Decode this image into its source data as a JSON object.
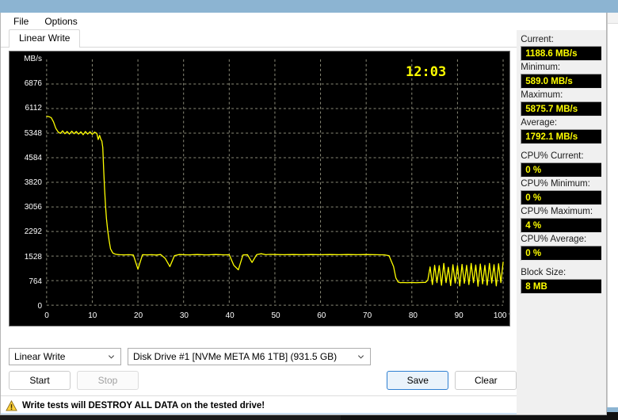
{
  "window": {
    "menu": [
      {
        "label": "File"
      },
      {
        "label": "Options"
      }
    ],
    "tabs": [
      {
        "label": "Linear Write",
        "active": true
      }
    ]
  },
  "chart": {
    "timer": "12:03",
    "y_axis_title": "MB/s",
    "x_axis_unit": "%",
    "y_ticks": [
      "6876",
      "6112",
      "5348",
      "4584",
      "3820",
      "3056",
      "2292",
      "1528",
      "764",
      "0"
    ],
    "x_ticks": [
      "0",
      "10",
      "20",
      "30",
      "40",
      "50",
      "60",
      "70",
      "80",
      "90",
      "100 %"
    ],
    "line_color": "#ffff00",
    "grid_color": "#8a8a78",
    "background_color": "#000000"
  },
  "chart_data": {
    "type": "line",
    "title": "Linear Write",
    "xlabel": "%",
    "ylabel": "MB/s",
    "xlim": [
      0,
      100
    ],
    "ylim": [
      0,
      7640
    ],
    "grid": true,
    "legend": null,
    "series": [
      {
        "name": "Linear Write",
        "color": "#ffff00",
        "x": [
          0,
          0.5,
          1,
          1.5,
          2,
          2.5,
          3,
          3.5,
          4,
          4.5,
          5,
          5.5,
          6,
          6.5,
          7,
          7.5,
          8,
          8.5,
          9,
          9.5,
          10,
          10.5,
          11,
          11.3,
          11.6,
          11.9,
          12.1,
          12.3,
          12.5,
          12.7,
          12.9,
          13.1,
          13.4,
          13.7,
          14,
          14.5,
          15,
          15.5,
          16,
          17,
          18,
          19,
          20,
          21,
          22,
          23,
          24,
          25,
          26,
          27,
          28,
          29,
          30,
          31,
          32,
          33,
          34,
          35,
          36,
          37,
          38,
          39,
          40,
          41,
          42,
          43,
          44,
          45,
          46,
          47,
          48,
          49,
          50,
          52,
          54,
          56,
          58,
          60,
          62,
          64,
          66,
          68,
          70,
          72,
          74,
          75,
          76,
          76.5,
          77,
          77.5,
          78,
          79,
          80,
          81,
          82,
          83,
          83.5,
          84,
          84.5,
          85,
          85.5,
          86,
          86.5,
          87,
          87.5,
          88,
          88.5,
          89,
          89.5,
          90,
          90.5,
          91,
          91.5,
          92,
          92.5,
          93,
          93.5,
          94,
          94.5,
          95,
          95.5,
          96,
          96.5,
          97,
          97.5,
          98,
          98.5,
          99,
          99.5,
          100
        ],
        "y": [
          5875,
          5860,
          5830,
          5700,
          5500,
          5390,
          5340,
          5420,
          5330,
          5400,
          5320,
          5410,
          5330,
          5400,
          5320,
          5390,
          5300,
          5400,
          5320,
          5390,
          5310,
          5380,
          5340,
          5150,
          5280,
          5150,
          5100,
          4900,
          4200,
          3600,
          3100,
          2700,
          2300,
          2000,
          1750,
          1620,
          1590,
          1575,
          1570,
          1565,
          1570,
          1560,
          1120,
          1570,
          1565,
          1570,
          1560,
          1575,
          1450,
          1200,
          1540,
          1575,
          1570,
          1565,
          1570,
          1575,
          1570,
          1565,
          1570,
          1575,
          1570,
          1565,
          1570,
          1240,
          1100,
          1560,
          1570,
          1330,
          1570,
          1600,
          1570,
          1580,
          1575,
          1570,
          1575,
          1570,
          1575,
          1570,
          1575,
          1570,
          1575,
          1570,
          1575,
          1570,
          1565,
          1540,
          1200,
          850,
          720,
          700,
          705,
          700,
          705,
          700,
          705,
          710,
          780,
          1190,
          640,
          1240,
          700,
          1230,
          620,
          1300,
          700,
          1180,
          610,
          1260,
          690,
          1230,
          600,
          1270,
          680,
          1240,
          640,
          1300,
          700,
          1250,
          590,
          1280,
          660,
          1240,
          620,
          1300,
          690,
          1260,
          600,
          1290,
          700,
          1340
        ]
      }
    ]
  },
  "controls": {
    "test_select": {
      "value": "Linear Write"
    },
    "drive_select": {
      "value": "Disk Drive #1  [NVMe   META M6 1TB]  (931.5 GB)"
    },
    "start_button": "Start",
    "stop_button": "Stop",
    "save_button": "Save",
    "clear_button": "Clear"
  },
  "warning": {
    "text": "Write tests will DESTROY ALL DATA on the tested drive!",
    "icon": "warning-triangle-icon"
  },
  "stats": [
    {
      "key": "current",
      "label": "Current:",
      "value": "1188.6 MB/s",
      "gap": false
    },
    {
      "key": "minimum",
      "label": "Minimum:",
      "value": "589.0 MB/s",
      "gap": false
    },
    {
      "key": "maximum",
      "label": "Maximum:",
      "value": "5875.7 MB/s",
      "gap": false
    },
    {
      "key": "average",
      "label": "Average:",
      "value": "1792.1 MB/s",
      "gap": false
    },
    {
      "key": "cpu_current",
      "label": "CPU% Current:",
      "value": "0 %",
      "gap": true
    },
    {
      "key": "cpu_minimum",
      "label": "CPU% Minimum:",
      "value": "0 %",
      "gap": false
    },
    {
      "key": "cpu_maximum",
      "label": "CPU% Maximum:",
      "value": "4 %",
      "gap": false
    },
    {
      "key": "cpu_average",
      "label": "CPU% Average:",
      "value": "0 %",
      "gap": false
    },
    {
      "key": "block_size",
      "label": "Block Size:",
      "value": "8 MB",
      "gap": true
    }
  ]
}
